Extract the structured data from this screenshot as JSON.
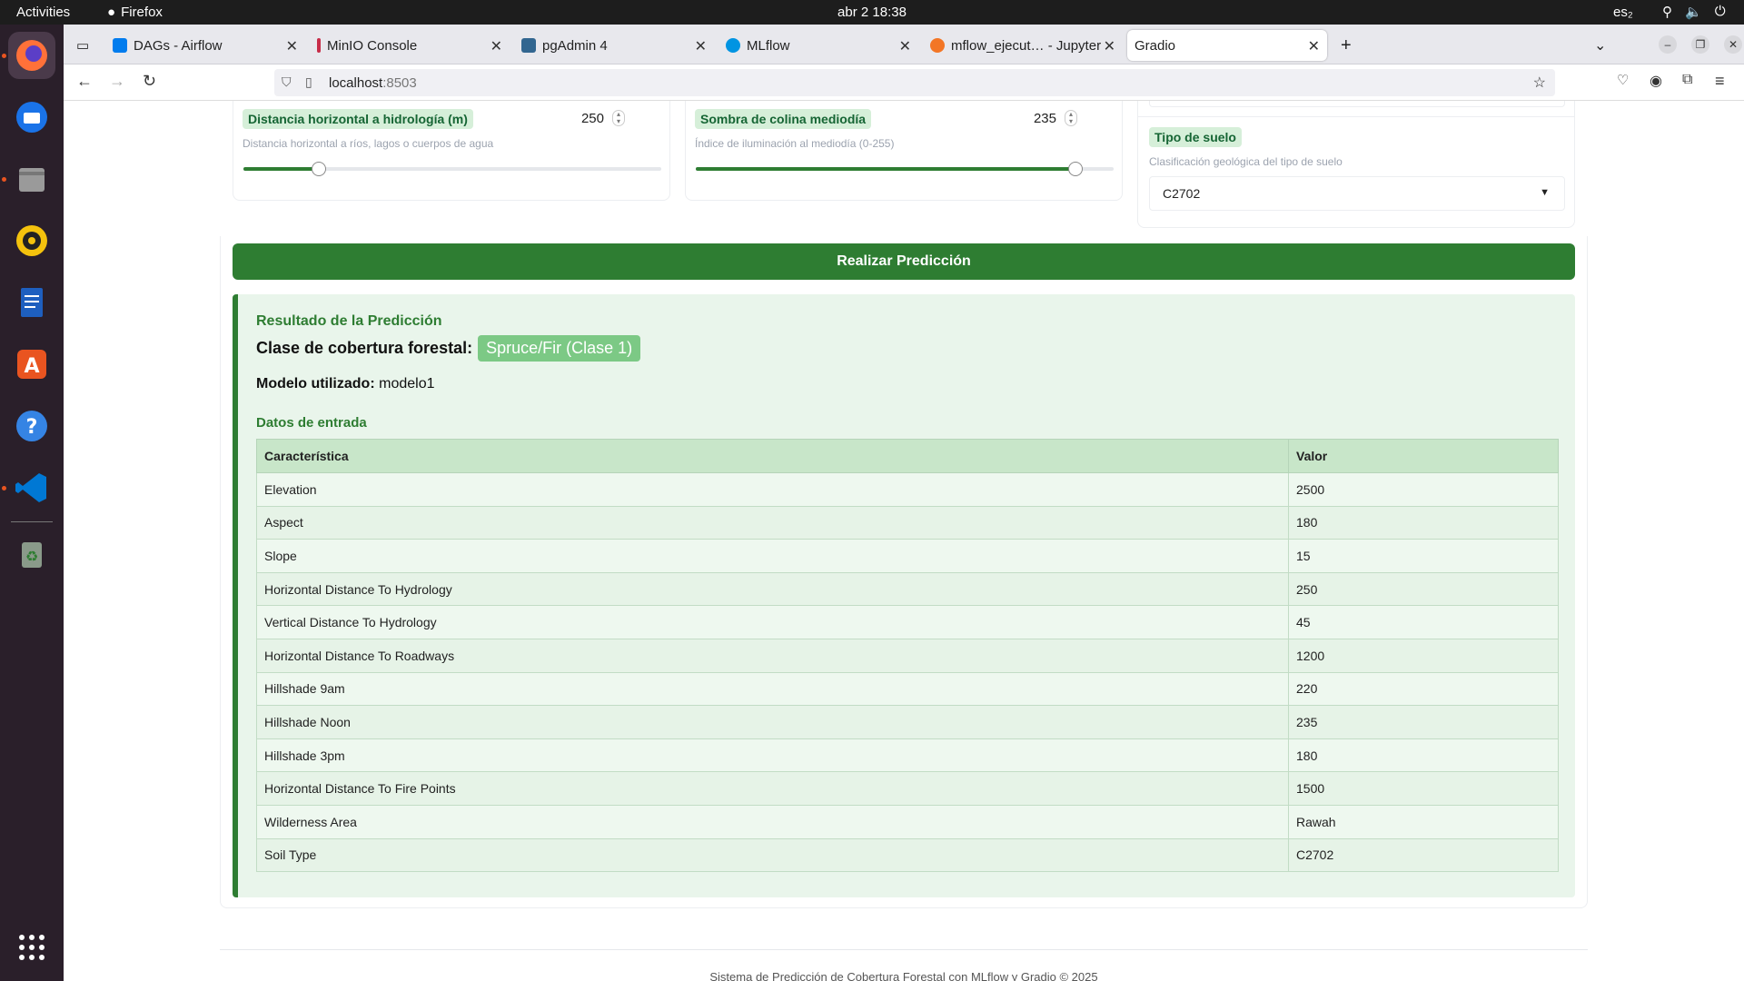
{
  "system": {
    "activities": "Activities",
    "app": "Firefox",
    "clock": "abr 2  18:38",
    "lang": "es₂"
  },
  "browser": {
    "tabs": [
      {
        "title": "DAGs - Airflow",
        "icon_color": "#017cee"
      },
      {
        "title": "MinIO Console",
        "icon_color": "#c72c48"
      },
      {
        "title": "pgAdmin 4",
        "icon_color": "#326690"
      },
      {
        "title": "MLflow",
        "icon_color": "#0194e2"
      },
      {
        "title": "mflow_ejecut… - Jupyter",
        "icon_color": "#f37626"
      },
      {
        "title": "Gradio",
        "icon_color": "#ffffff"
      }
    ],
    "url_host": "localhost",
    "url_port": ":8503"
  },
  "inputs": {
    "hidrologia": {
      "label": "Distancia horizontal a hidrología (m)",
      "info": "Distancia horizontal a ríos, lagos o cuerpos de agua",
      "value": "250",
      "slider_fraction": 0.18
    },
    "sombra": {
      "label": "Sombra de colina mediodía",
      "info": "Índice de iluminación al mediodía (0-255)",
      "value": "235",
      "slider_fraction": 0.908
    },
    "suelo": {
      "label": "Tipo de suelo",
      "info": "Clasificación geológica del tipo de suelo",
      "value": "C2702"
    }
  },
  "predict_button": "Realizar Predicción",
  "result": {
    "heading": "Resultado de la Predicción",
    "class_label": "Clase de cobertura forestal:",
    "class_value": "Spruce/Fir (Clase 1)",
    "model_label": "Modelo utilizado:",
    "model_value": "modelo1",
    "input_heading": "Datos de entrada",
    "columns": [
      "Característica",
      "Valor"
    ],
    "rows": [
      [
        "Elevation",
        "2500"
      ],
      [
        "Aspect",
        "180"
      ],
      [
        "Slope",
        "15"
      ],
      [
        "Horizontal Distance To Hydrology",
        "250"
      ],
      [
        "Vertical Distance To Hydrology",
        "45"
      ],
      [
        "Horizontal Distance To Roadways",
        "1200"
      ],
      [
        "Hillshade 9am",
        "220"
      ],
      [
        "Hillshade Noon",
        "235"
      ],
      [
        "Hillshade 3pm",
        "180"
      ],
      [
        "Horizontal Distance To Fire Points",
        "1500"
      ],
      [
        "Wilderness Area",
        "Rawah"
      ],
      [
        "Soil Type",
        "C2702"
      ]
    ]
  },
  "footer": "Sistema de Predicción de Cobertura Forestal con MLflow y Gradio © 2025",
  "colors": {
    "accent": "#2e7d32",
    "label_bg": "#d6efd9",
    "result_bg": "#e9f5eb"
  }
}
